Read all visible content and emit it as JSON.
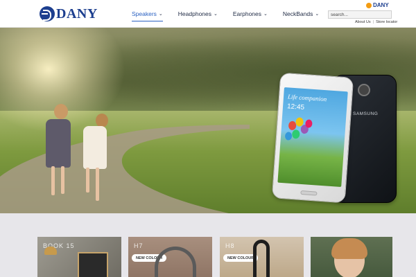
{
  "brand": {
    "logo_text": "DANY",
    "mini_logo_text": "DANY"
  },
  "nav": {
    "items": [
      {
        "label": "Speakers",
        "active": true
      },
      {
        "label": "Headphones",
        "active": false
      },
      {
        "label": "Earphones",
        "active": false
      },
      {
        "label": "NeckBands",
        "active": false
      }
    ],
    "chevron": "⌄"
  },
  "search": {
    "placeholder": "search..."
  },
  "util_links": {
    "about": "About Us",
    "separator": "|",
    "store": "Store locator"
  },
  "hero": {
    "phone_headline": "Life companion",
    "phone_time": "12:45",
    "phone_brand": "SAMSUNG"
  },
  "tiles": [
    {
      "code": "BOOK 15",
      "badge": ""
    },
    {
      "code": "H7",
      "badge": "NEW COLOUR"
    },
    {
      "code": "H8",
      "badge": "NEW COLOUR"
    },
    {
      "code": "",
      "badge": ""
    }
  ],
  "colors": {
    "brand_blue": "#1d3f8f",
    "active_nav": "#2a61c2",
    "accent_orange": "#f39c12",
    "band_bg": "#e7e6ea"
  }
}
